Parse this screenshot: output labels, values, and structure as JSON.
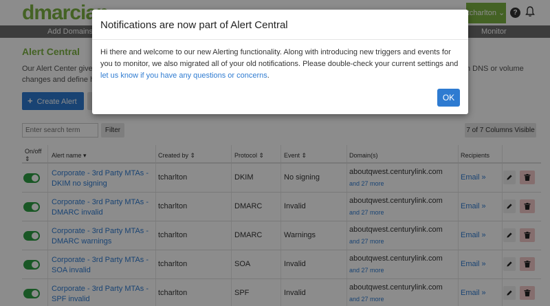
{
  "header": {
    "logo": "dmarcian",
    "user": "tcharlton",
    "user_chevron": "⌄"
  },
  "nav": {
    "items": [
      "Add Domains",
      "Monitor"
    ]
  },
  "page": {
    "title": "Alert Central",
    "desc_line1_left": "Our Alert Center give",
    "desc_line1_right": "n DNS or volume",
    "desc_line2": "changes and define h",
    "create_button": "Create Alert"
  },
  "toolbar": {
    "search_placeholder": "Enter search term",
    "filter_button": "Filter",
    "columns_visible": "7 of 7 Columns Visible"
  },
  "table": {
    "headers": {
      "onoff": "On/off",
      "sort_glyph": "⇕",
      "alert_name": "Alert name ▾",
      "created_by": "Created by ⇕",
      "protocol": "Protocol ⇕",
      "event": "Event ⇕",
      "domains": "Domain(s)",
      "recipients": "Recipients"
    },
    "rows": [
      {
        "name": "Corporate - 3rd Party MTAs - DKIM no signing",
        "created_by": "tcharlton",
        "protocol": "DKIM",
        "event": "No signing",
        "domain": "aboutqwest.centurylink.com",
        "more": "and 27 more",
        "recipients": "Email »"
      },
      {
        "name": "Corporate - 3rd Party MTAs - DMARC invalid",
        "created_by": "tcharlton",
        "protocol": "DMARC",
        "event": "Invalid",
        "domain": "aboutqwest.centurylink.com",
        "more": "and 27 more",
        "recipients": "Email »"
      },
      {
        "name": "Corporate - 3rd Party MTAs - DMARC warnings",
        "created_by": "tcharlton",
        "protocol": "DMARC",
        "event": "Warnings",
        "domain": "aboutqwest.centurylink.com",
        "more": "and 27 more",
        "recipients": "Email »"
      },
      {
        "name": "Corporate - 3rd Party MTAs - SOA invalid",
        "created_by": "tcharlton",
        "protocol": "SOA",
        "event": "Invalid",
        "domain": "aboutqwest.centurylink.com",
        "more": "and 27 more",
        "recipients": "Email »"
      },
      {
        "name": "Corporate - 3rd Party MTAs - SPF invalid",
        "created_by": "tcharlton",
        "protocol": "SPF",
        "event": "Invalid",
        "domain": "aboutqwest.centurylink.com",
        "more": "and 27 more",
        "recipients": "Email »"
      }
    ]
  },
  "modal": {
    "title": "Notifications are now part of Alert Central",
    "body_line1": "Hi there and welcome to our new Alerting functionality. Along with introducing new triggers and events for",
    "body_line2": "you to monitor, we also migrated all of your old notifications. Please double-check your current settings and",
    "body_link": "let us know if you have any questions or concerns",
    "body_end": ".",
    "ok_button": "OK"
  },
  "colors": {
    "brand_green": "#7cb342",
    "primary_blue": "#2e7bd1",
    "toggle_green": "#2e9e44"
  }
}
